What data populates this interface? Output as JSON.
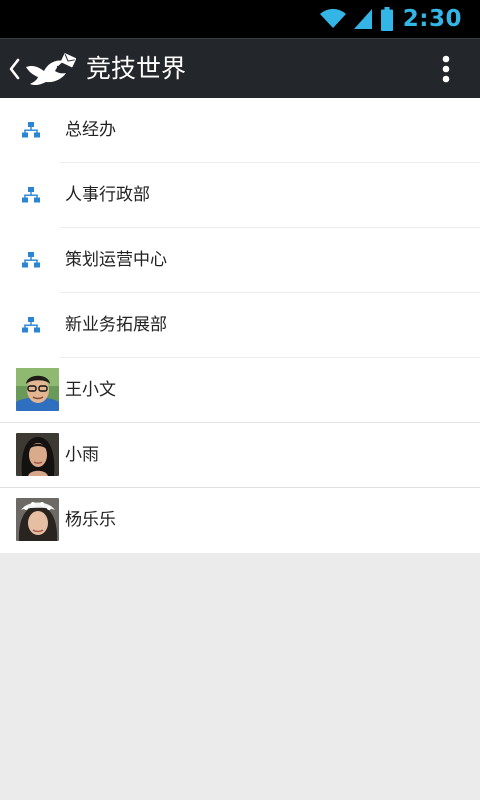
{
  "status_bar": {
    "time": "2:30",
    "icons": [
      "wifi-icon",
      "signal-icon",
      "battery-icon"
    ],
    "accent_color": "#33b5e5"
  },
  "action_bar": {
    "title": "竞技世界",
    "icons": [
      "back-icon",
      "bird-logo-icon",
      "overflow-menu-icon"
    ],
    "background": "#23262a"
  },
  "departments": [
    {
      "label": "总经办",
      "icon": "org-chart-icon"
    },
    {
      "label": "人事行政部",
      "icon": "org-chart-icon"
    },
    {
      "label": "策划运营中心",
      "icon": "org-chart-icon"
    },
    {
      "label": "新业务拓展部",
      "icon": "org-chart-icon"
    }
  ],
  "members": [
    {
      "name": "王小文",
      "icon": "avatar"
    },
    {
      "name": "小雨",
      "icon": "avatar"
    },
    {
      "name": "杨乐乐",
      "icon": "avatar"
    }
  ],
  "colors": {
    "dept_icon": "#2a86d3",
    "background": "#ebebeb"
  }
}
